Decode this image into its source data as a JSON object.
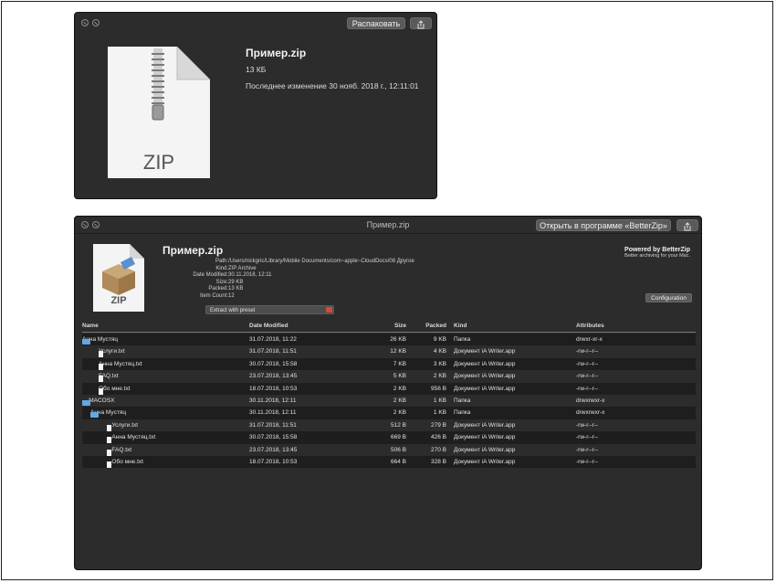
{
  "quicklook": {
    "extract_button": "Распаковать",
    "file_name": "Пример.zip",
    "file_size": "13 КБ",
    "modified": "Последнее изменение 30 нояб. 2018 г., 12:11:01",
    "icon_label": "ZIP"
  },
  "betterzip": {
    "window_title": "Пример.zip",
    "open_button": "Открыть в программе «BetterZip»",
    "archive_name": "Пример.zip",
    "icon_label": "ZIP",
    "info": [
      {
        "key": "Path:",
        "value": "/Users/nickgric/Library/Mobile Documents/com~apple~CloudDocs/08 Другое"
      },
      {
        "key": "Kind:",
        "value": "ZIP Archive"
      },
      {
        "key": "Date Modified:",
        "value": "30.11.2018, 12:11"
      },
      {
        "key": "Size:",
        "value": "29 KB"
      },
      {
        "key": "Packed:",
        "value": "13 KB"
      },
      {
        "key": "Item Count:",
        "value": "12"
      }
    ],
    "preset_select": "Extract with preset",
    "powered_title": "Powered by BetterZip",
    "powered_sub": "Better archiving for your Mac.",
    "configuration_button": "Configuration",
    "columns": {
      "name": "Name",
      "date": "Date Modified",
      "size": "Size",
      "packed": "Packed",
      "kind": "Kind",
      "attributes": "Attributes"
    },
    "rows": [
      {
        "name": "Анна Мустяц",
        "type": "folder",
        "expanded": true,
        "depth": 0,
        "date": "31.07.2018, 11:22",
        "size": "26 KB",
        "packed": "9 KB",
        "kind": "Папка",
        "attr": "drwxr-xr-x"
      },
      {
        "name": "Услуги.txt",
        "type": "file",
        "depth": 1,
        "date": "31.07.2018, 11:51",
        "size": "12 KB",
        "packed": "4 KB",
        "kind": "Документ iA Writer.app",
        "attr": "-rw-r--r--"
      },
      {
        "name": "Анна Мустяц.txt",
        "type": "file",
        "depth": 1,
        "date": "30.07.2018, 15:58",
        "size": "7 KB",
        "packed": "3 KB",
        "kind": "Документ iA Writer.app",
        "attr": "-rw-r--r--"
      },
      {
        "name": "FAQ.txt",
        "type": "file",
        "depth": 1,
        "date": "23.07.2018, 13:45",
        "size": "5 KB",
        "packed": "2 KB",
        "kind": "Документ iA Writer.app",
        "attr": "-rw-r--r--"
      },
      {
        "name": "Обо мне.txt",
        "type": "file",
        "depth": 1,
        "date": "18.07.2018, 10:53",
        "size": "2 KB",
        "packed": "956 B",
        "kind": "Документ iA Writer.app",
        "attr": "-rw-r--r--"
      },
      {
        "name": "__MACOSX",
        "type": "folder",
        "expanded": true,
        "depth": 0,
        "date": "30.11.2018, 12:11",
        "size": "2 KB",
        "packed": "1 KB",
        "kind": "Папка",
        "attr": "drwxrwxr-x"
      },
      {
        "name": "Анна Мустяц",
        "type": "folder",
        "expanded": true,
        "depth": 1,
        "date": "30.11.2018, 12:11",
        "size": "2 KB",
        "packed": "1 KB",
        "kind": "Папка",
        "attr": "drwxrwxr-x"
      },
      {
        "name": "._Услуги.txt",
        "type": "file",
        "depth": 2,
        "date": "31.07.2018, 11:51",
        "size": "512 B",
        "packed": "279 B",
        "kind": "Документ iA Writer.app",
        "attr": "-rw-r--r--"
      },
      {
        "name": "._Анна Мустяц.txt",
        "type": "file",
        "depth": 2,
        "date": "30.07.2018, 15:58",
        "size": "669 B",
        "packed": "426 B",
        "kind": "Документ iA Writer.app",
        "attr": "-rw-r--r--"
      },
      {
        "name": "._FAQ.txt",
        "type": "file",
        "depth": 2,
        "date": "23.07.2018, 13:45",
        "size": "506 B",
        "packed": "270 B",
        "kind": "Документ iA Writer.app",
        "attr": "-rw-r--r--"
      },
      {
        "name": "._Обо мне.txt",
        "type": "file",
        "depth": 2,
        "date": "18.07.2018, 10:53",
        "size": "664 B",
        "packed": "328 B",
        "kind": "Документ iA Writer.app",
        "attr": "-rw-r--r--"
      }
    ]
  }
}
